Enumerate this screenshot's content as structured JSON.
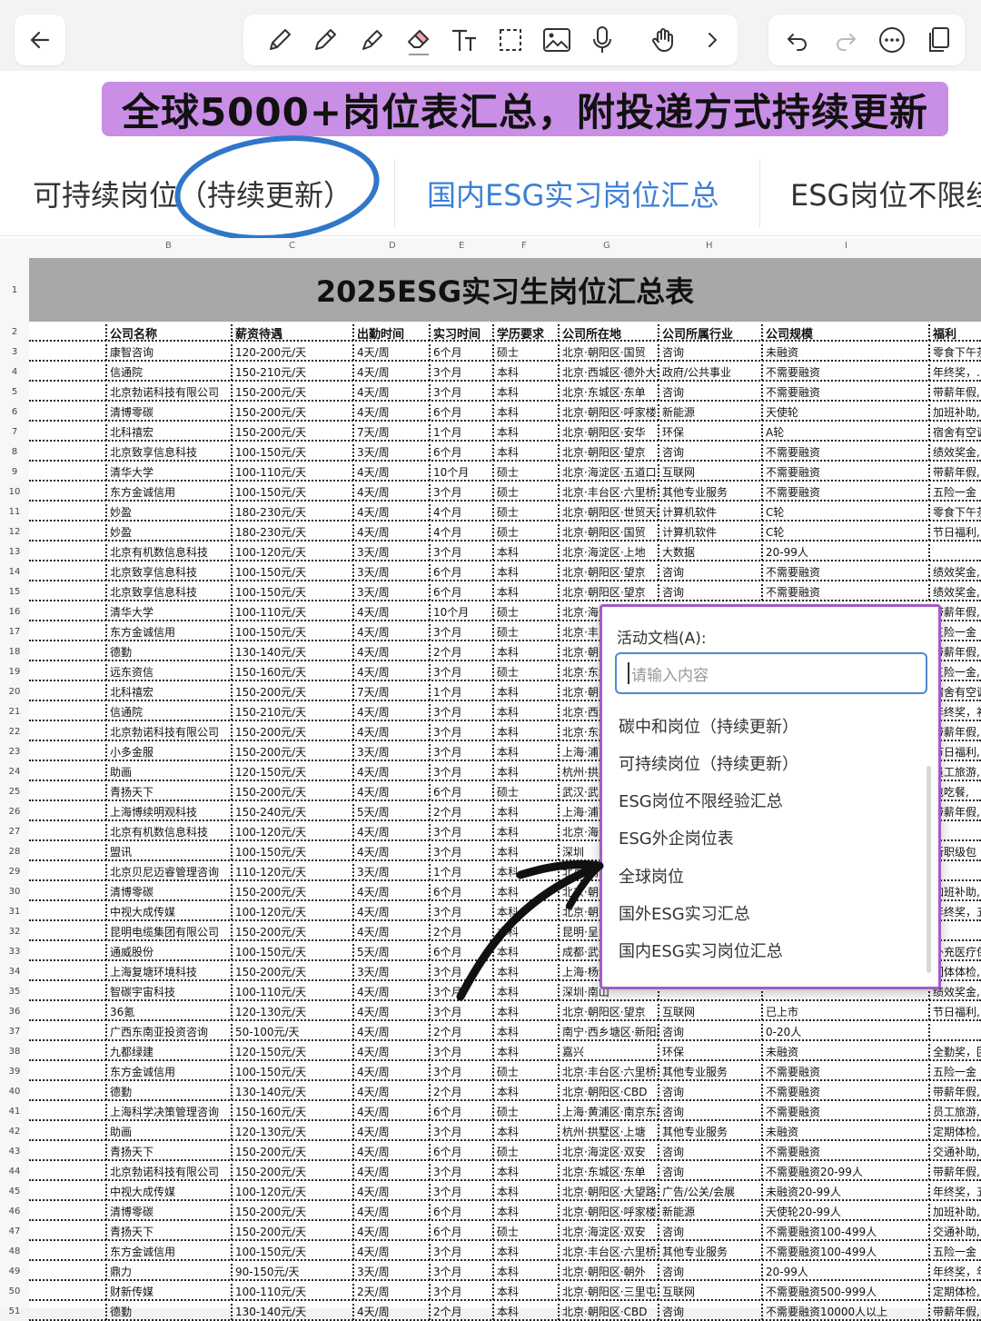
{
  "toolbar": {
    "back_icon": "back-arrow-icon",
    "tools": [
      "pen-icon",
      "pencil-icon",
      "highlighter-icon",
      "eraser-icon",
      "text-tool-icon",
      "lasso-select-icon",
      "image-icon",
      "microphone-icon",
      "hand-gesture-icon",
      "chevron-right-icon"
    ],
    "actions": [
      "undo-icon",
      "redo-icon",
      "more-icon",
      "copy-icon"
    ]
  },
  "banner": {
    "text": "全球5000+岗位表汇总，附投递方式持续更新"
  },
  "tabs": [
    {
      "label": "可持续岗位（持续更新）"
    },
    {
      "label": "国内ESG实习岗位汇总"
    },
    {
      "label": "ESG岗位不限经"
    }
  ],
  "column_letters": [
    "B",
    "C",
    "D",
    "E",
    "F",
    "G",
    "H",
    "I"
  ],
  "sheet_title": "2025ESG实习生岗位汇总表",
  "headers": [
    "公司名称",
    "薪资待遇",
    "出勤时间",
    "实习时间",
    "学历要求",
    "公司所在地",
    "公司所属行业",
    "公司规模",
    "福利"
  ],
  "rows": [
    [
      "康智咨询",
      "120-200元/天",
      "4天/周",
      "6个月",
      "硕士",
      "北京·朝阳区·国贸",
      "咨询",
      "未融资",
      "零食下午茶"
    ],
    [
      "信通院",
      "150-210元/天",
      "4天/周",
      "3个月",
      "本科",
      "北京·西城区·德外大街",
      "政府/公共事业",
      "不需要融资",
      "年终奖，..."
    ],
    [
      "北京勃诺科技有限公司",
      "150-200元/天",
      "4天/周",
      "3个月",
      "本科",
      "北京·东城区·东单",
      "咨询",
      "不需要融资",
      "带薪年假,"
    ],
    [
      "清博零碳",
      "150-200元/天",
      "4天/周",
      "6个月",
      "本科",
      "北京·朝阳区·呼家楼",
      "新能源",
      "天使轮",
      "加班补助,"
    ],
    [
      "北科禧宏",
      "150-200元/天",
      "7天/周",
      "1个月",
      "本科",
      "北京·朝阳区·安华",
      "环保",
      "A轮",
      "宿舍有空调"
    ],
    [
      "北京致享信息科技",
      "100-150元/天",
      "3天/周",
      "6个月",
      "本科",
      "北京·朝阳区·望京",
      "咨询",
      "不需要融资",
      "绩效奖金,"
    ],
    [
      "清华大学",
      "100-110元/天",
      "4天/周",
      "10个月",
      "硕士",
      "北京·海淀区·五道口",
      "互联网",
      "不需要融资",
      "带薪年假,"
    ],
    [
      "东方金诚信用",
      "100-150元/天",
      "4天/周",
      "3个月",
      "硕士",
      "北京·丰台区·六里桥",
      "其他专业服务",
      "不需要融资",
      "五险一金"
    ],
    [
      "妙盈",
      "180-230元/天",
      "4天/周",
      "4个月",
      "硕士",
      "北京·朝阳区·世贸天阶",
      "计算机软件",
      "C轮",
      "零食下午茶"
    ],
    [
      "妙盈",
      "180-230元/天",
      "4天/周",
      "4个月",
      "硕士",
      "北京·朝阳区·国贸",
      "计算机软件",
      "C轮",
      "节日福利,"
    ],
    [
      "北京有机数信息科技",
      "100-120元/天",
      "3天/周",
      "3个月",
      "本科",
      "北京·海淀区·上地",
      "大数据",
      "20-99人",
      ""
    ],
    [
      "北京致享信息科技",
      "100-150元/天",
      "3天/周",
      "6个月",
      "本科",
      "北京·朝阳区·望京",
      "咨询",
      "不需要融资",
      "绩效奖金,"
    ],
    [
      "北京致享信息科技",
      "100-150元/天",
      "3天/周",
      "6个月",
      "本科",
      "北京·朝阳区·望京",
      "咨询",
      "不需要融资",
      "绩效奖金,"
    ],
    [
      "清华大学",
      "100-110元/天",
      "4天/周",
      "10个月",
      "硕士",
      "北京·海淀",
      "",
      "",
      "带薪年假,"
    ],
    [
      "东方金诚信用",
      "100-150元/天",
      "4天/周",
      "3个月",
      "硕士",
      "北京·丰台",
      "",
      "",
      "五险一金"
    ],
    [
      "德勤",
      "130-140元/天",
      "4天/周",
      "2个月",
      "本科",
      "北京·朝阳",
      "",
      "",
      "带薪年假,"
    ],
    [
      "远东资信",
      "150-160元/天",
      "4天/周",
      "3个月",
      "硕士",
      "北京·东城",
      "",
      "",
      "五险一金,"
    ],
    [
      "北科禧宏",
      "150-200元/天",
      "7天/周",
      "1个月",
      "本科",
      "北京·朝阳",
      "",
      "",
      "宿舍有空调"
    ],
    [
      "信通院",
      "150-210元/天",
      "4天/周",
      "3个月",
      "本科",
      "北京·西城",
      "",
      "",
      "年终奖，补"
    ],
    [
      "北京勃诺科技有限公司",
      "150-200元/天",
      "4天/周",
      "3个月",
      "本科",
      "北京·东城",
      "",
      "",
      "带薪年假,"
    ],
    [
      "小多金服",
      "150-200元/天",
      "3天/周",
      "3个月",
      "本科",
      "上海·浦东",
      "",
      "",
      "节日福利,"
    ],
    [
      "助画",
      "120-150元/天",
      "4天/周",
      "3个月",
      "本科",
      "杭州·拱墅",
      "",
      "",
      "员工旅游,"
    ],
    [
      "青扬天下",
      "150-200元/天",
      "4天/周",
      "6个月",
      "硕士",
      "武汉·武昌",
      "",
      "",
      "包吃餐,"
    ],
    [
      "上海博续明观科技",
      "150-240元/天",
      "5天/周",
      "2个月",
      "本科",
      "上海·浦东",
      "",
      "",
      "带薪年假,"
    ],
    [
      "北京有机数信息科技",
      "100-120元/天",
      "4天/周",
      "3个月",
      "本科",
      "北京·海淀",
      "",
      "",
      ""
    ],
    [
      "盟讯",
      "100-150元/天",
      "4天/周",
      "3个月",
      "本科",
      "深圳",
      "",
      "",
      "新职级包"
    ],
    [
      "北京贝尼迈睿管理咨询",
      "110-120元/天",
      "3天/周",
      "1个月",
      "本科",
      "北京·朝阳",
      "",
      "",
      ""
    ],
    [
      "清博零碳",
      "150-200元/天",
      "4天/周",
      "6个月",
      "本科",
      "北京·朝阳",
      "",
      "",
      "加班补助,"
    ],
    [
      "中视大成传媒",
      "100-120元/天",
      "4天/周",
      "3个月",
      "本科",
      "北京·朝阳",
      "",
      "",
      "年终奖，五"
    ],
    [
      "昆明电缆集团有限公司",
      "150-200元/天",
      "4天/周",
      "2个月",
      "本科",
      "昆明·呈贡",
      "",
      "",
      ""
    ],
    [
      "通威股份",
      "100-150元/天",
      "5天/周",
      "6个月",
      "本科",
      "成都·武侯",
      "",
      "",
      "补充医疗保"
    ],
    [
      "上海复塘环境科技",
      "150-200元/天",
      "3天/周",
      "3个月",
      "本科",
      "上海·杨浦",
      "",
      "",
      "团体体检,"
    ],
    [
      "智碳宇宙科技",
      "100-110元/天",
      "4天/周",
      "3个月",
      "本科",
      "深圳·南山",
      "",
      "",
      "绩效奖金,"
    ],
    [
      "36氪",
      "120-130元/天",
      "4天/周",
      "3个月",
      "本科",
      "北京·朝阳区·望京",
      "互联网",
      "已上市",
      "节日福利,"
    ],
    [
      "广西东南亚投资咨询",
      "50-100元/天",
      "4天/周",
      "2个月",
      "本科",
      "南宁·西乡塘区·新阳路",
      "咨询",
      "0-20人",
      ""
    ],
    [
      "九都绿建",
      "120-150元/天",
      "4天/周",
      "3个月",
      "本科",
      "嘉兴",
      "环保",
      "未融资",
      "全勤奖，团"
    ],
    [
      "东方金诚信用",
      "100-150元/天",
      "4天/周",
      "3个月",
      "硕士",
      "北京·丰台区·六里桥",
      "其他专业服务",
      "不需要融资",
      "五险一金"
    ],
    [
      "德勤",
      "130-140元/天",
      "4天/周",
      "2个月",
      "本科",
      "北京·朝阳区·CBD",
      "咨询",
      "不需要融资",
      "带薪年假,"
    ],
    [
      "上海科学决策管理咨询",
      "150-160元/天",
      "4天/周",
      "6个月",
      "硕士",
      "上海·黄浦区·南京东路",
      "咨询",
      "不需要融资",
      "员工旅游,"
    ],
    [
      "助画",
      "120-130元/天",
      "4天/周",
      "3个月",
      "本科",
      "杭州·拱墅区·上塘",
      "其他专业服务",
      "未融资",
      "定期体检,"
    ],
    [
      "青扬天下",
      "150-200元/天",
      "4天/周",
      "6个月",
      "硕士",
      "北京·海淀区·双安",
      "咨询",
      "不需要融资",
      "交通补助,"
    ],
    [
      "北京勃诺科技有限公司",
      "150-200元/天",
      "4天/周",
      "3个月",
      "本科",
      "北京·东城区·东单",
      "咨询",
      "不需要融资20-99人",
      "带薪年假,"
    ],
    [
      "中视大成传媒",
      "100-120元/天",
      "4天/周",
      "3个月",
      "本科",
      "北京·朝阳区·大望路",
      "广告/公关/会展",
      "未融资20-99人",
      "年终奖，五"
    ],
    [
      "清博零碳",
      "150-200元/天",
      "4天/周",
      "6个月",
      "本科",
      "北京·朝阳区·呼家楼",
      "新能源",
      "天使轮20-99人",
      "加班补助,"
    ],
    [
      "青扬天下",
      "150-200元/天",
      "4天/周",
      "6个月",
      "硕士",
      "北京·海淀区·双安",
      "咨询",
      "不需要融资100-499人",
      "交通补助,"
    ],
    [
      "东方金诚信用",
      "100-150元/天",
      "4天/周",
      "3个月",
      "本科",
      "北京·丰台区·六里桥",
      "其他专业服务",
      "不需要融资100-499人",
      "五险一金"
    ],
    [
      "鼎力",
      "90-150元/天",
      "3天/周",
      "3个月",
      "本科",
      "北京·朝阳区·朝外",
      "咨询",
      "20-99人",
      "年终奖，年"
    ],
    [
      "财新传媒",
      "100-110元/天",
      "2天/周",
      "3个月",
      "本科",
      "北京·朝阳区·三里屯",
      "互联网",
      "不需要融资500-999人",
      "定期体检,"
    ],
    [
      "德勤",
      "130-140元/天",
      "4天/周",
      "2个月",
      "本科",
      "北京·朝阳区·CBD",
      "咨询",
      "不需要融资10000人以上",
      "带薪年假,"
    ]
  ],
  "popup": {
    "label": "活动文档(A):",
    "input_placeholder": "请输入内容",
    "items": [
      "碳中和岗位（持续更新）",
      "可持续岗位（持续更新）",
      "ESG岗位不限经验汇总",
      "ESG外企岗位表",
      "全球岗位",
      "国外ESG实习汇总",
      "国内ESG实习岗位汇总"
    ]
  },
  "colors": {
    "banner_bg": "#c98ee6",
    "circle": "#2f77c9",
    "popup_border": "#a35bc7",
    "active_tab": "#3b7fd6",
    "title_band": "#a8a8a8"
  }
}
